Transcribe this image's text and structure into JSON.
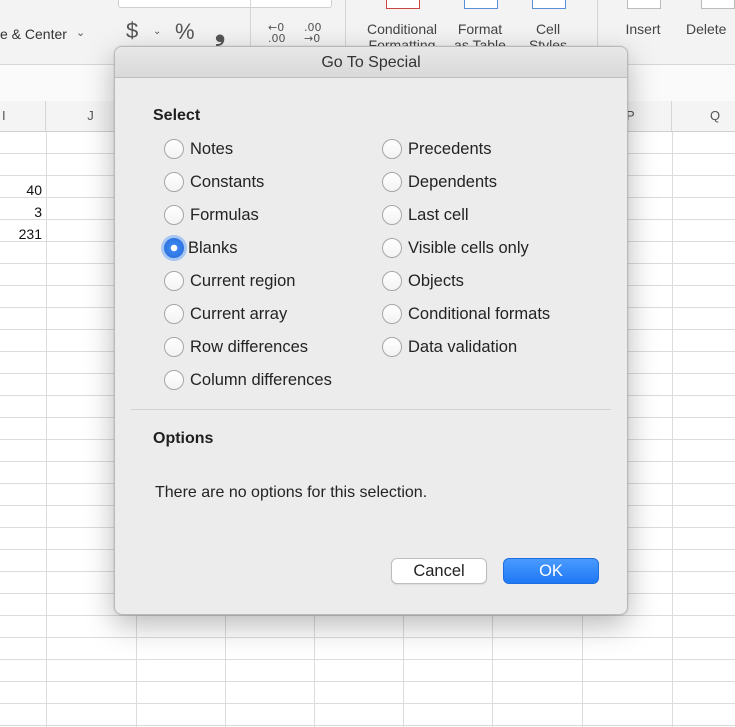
{
  "ribbon": {
    "merge_label": "e & Center",
    "number_format": {
      "currency_icon": "$",
      "percent_icon": "%",
      "comma_icon": "❟"
    },
    "increase_decimal_icon": {
      "top": "←0",
      "bottom": ".00"
    },
    "decrease_decimal_icon": {
      "top": ".00",
      "bottom": "→0"
    },
    "buttons": [
      {
        "line1": "Conditional",
        "line2": "Formatting"
      },
      {
        "line1": "Format",
        "line2": "as Table"
      },
      {
        "line1": "Cell",
        "line2": "Styles"
      },
      {
        "line1": "Insert",
        "line2": ""
      },
      {
        "line1": "Delete",
        "line2": ""
      }
    ]
  },
  "sheet": {
    "columns": [
      "I",
      "J",
      "P",
      "Q"
    ],
    "cells": [
      "40",
      "3",
      "231"
    ]
  },
  "dialog": {
    "title": "Go To Special",
    "select_heading": "Select",
    "left_options": [
      "Notes",
      "Constants",
      "Formulas",
      "Blanks",
      "Current region",
      "Current array",
      "Row differences",
      "Column differences"
    ],
    "right_options": [
      "Precedents",
      "Dependents",
      "Last cell",
      "Visible cells only",
      "Objects",
      "Conditional formats",
      "Data validation"
    ],
    "selected_option": "Blanks",
    "options_heading": "Options",
    "options_message": "There are no options for this selection.",
    "cancel_label": "Cancel",
    "ok_label": "OK"
  },
  "colors": {
    "accent": "#2f73e0",
    "dialog_bg": "#ececec"
  }
}
